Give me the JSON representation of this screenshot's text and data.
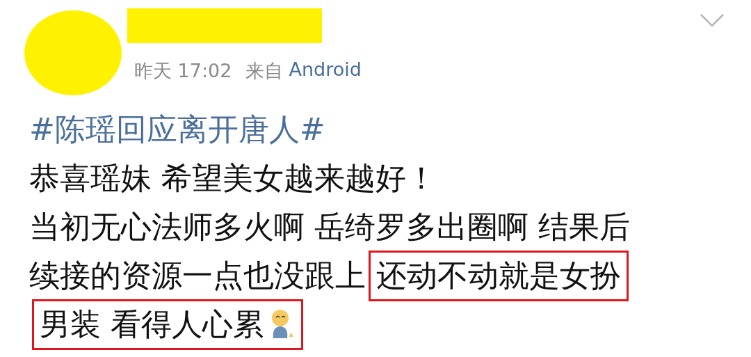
{
  "post": {
    "time": "昨天 17:02",
    "source_prefix": "来自",
    "source": "Android"
  },
  "hashtag": "#陈瑶回应离开唐人#",
  "lines": [
    [
      {
        "text": "恭喜瑶妹 希望美女越来越好！",
        "highlighted": false
      }
    ],
    [
      {
        "text": "当初无心法师多火啊 岳绮罗多出圈啊 结果后",
        "highlighted": false
      }
    ],
    [
      {
        "text": "续接的资源一点也没跟上",
        "highlighted": false
      },
      {
        "text": "还动不动就是女扮",
        "highlighted": true
      }
    ],
    [
      {
        "text": "男装 看得人心累",
        "highlighted": true,
        "emoji": true
      }
    ]
  ]
}
